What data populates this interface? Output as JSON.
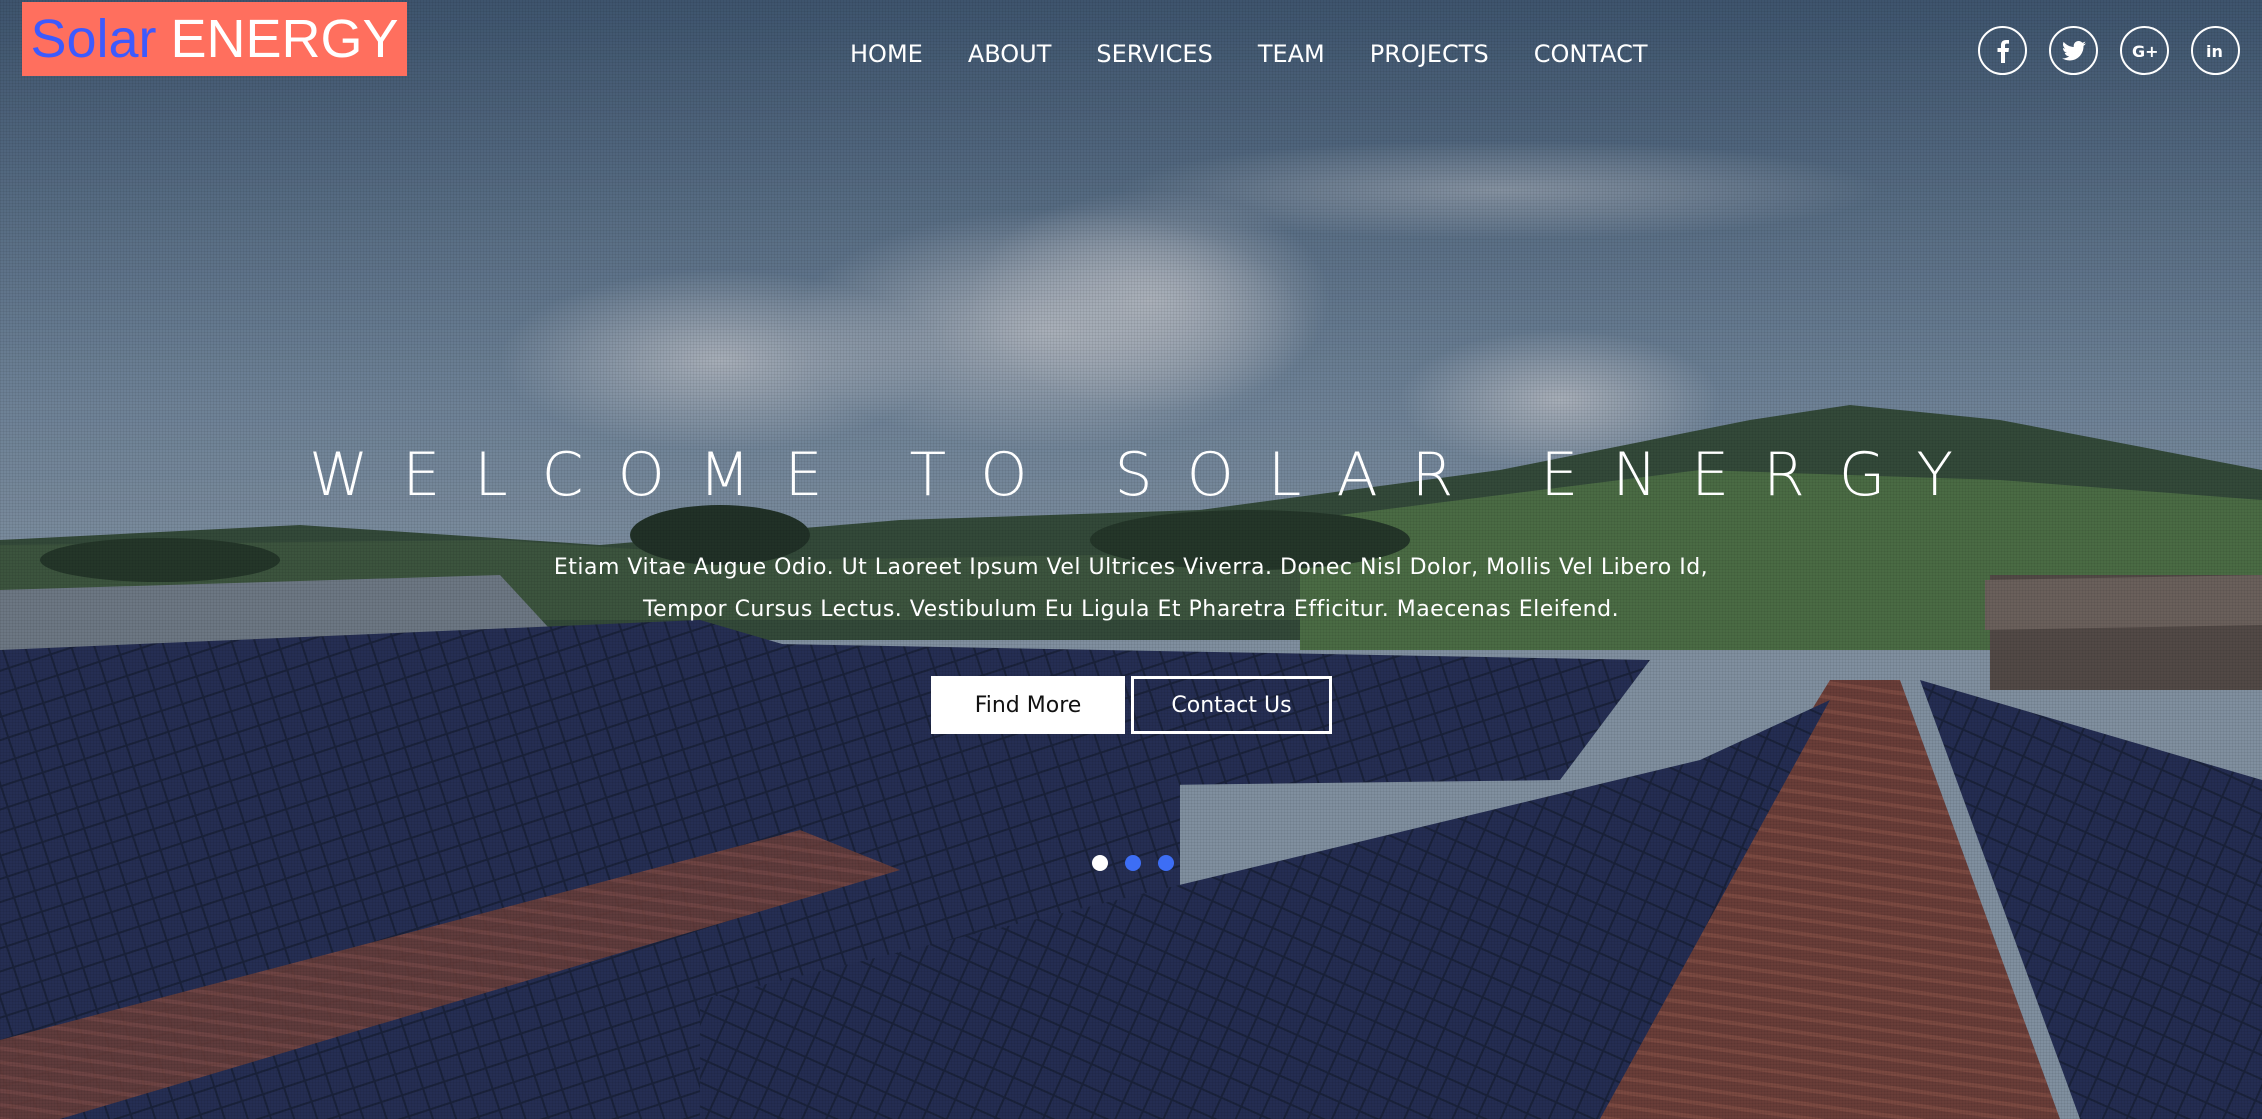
{
  "brand": {
    "word1": "Solar",
    "word2": "ENERGY",
    "bg_color": "#ff6f5e",
    "word1_color": "#3d5afe"
  },
  "nav": {
    "items": [
      {
        "label": "HOME"
      },
      {
        "label": "ABOUT"
      },
      {
        "label": "SERVICES"
      },
      {
        "label": "TEAM"
      },
      {
        "label": "PROJECTS"
      },
      {
        "label": "CONTACT"
      }
    ]
  },
  "social": {
    "icons": [
      "facebook-icon",
      "twitter-icon",
      "google-plus-icon",
      "linkedin-icon"
    ]
  },
  "hero": {
    "title": "WELCOME TO SOLAR ENERGY",
    "subtitle_line1": "Etiam Vitae Augue Odio. Ut Laoreet Ipsum Vel Ultrices Viverra. Donec Nisl Dolor, Mollis Vel Libero Id,",
    "subtitle_line2": "Tempor Cursus Lectus. Vestibulum Eu Ligula Et Pharetra Efficitur. Maecenas Eleifend.",
    "primary_button": "Find More",
    "secondary_button": "Contact Us"
  },
  "carousel": {
    "active_index": 0,
    "count": 3,
    "active_color": "#ffffff",
    "inactive_color": "#3d6ef5"
  }
}
